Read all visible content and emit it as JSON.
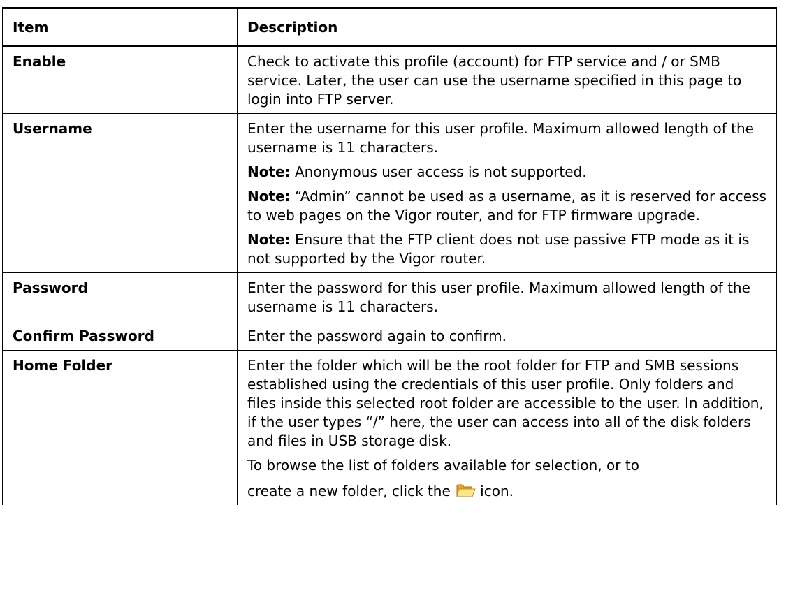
{
  "table": {
    "headers": [
      "Item",
      "Description"
    ],
    "rows": [
      {
        "item": "Enable",
        "paragraphs": [
          {
            "text": "Check to activate this profile (account) for FTP service and / or SMB service. Later, the user can use the username specified in this page to login into FTP server."
          }
        ]
      },
      {
        "item": "Username",
        "paragraphs": [
          {
            "text": "Enter the username for this user profile. Maximum allowed length of the username is 11 characters."
          },
          {
            "note": "Note:",
            "text": " Anonymous user access is not supported."
          },
          {
            "note": "Note:",
            "text": " “Admin” cannot be used as a username, as it is reserved for access to web pages on the Vigor router, and for FTP firmware upgrade."
          },
          {
            "note": "Note:",
            "text": " Ensure that the FTP client does not use passive FTP mode as it is not supported by the Vigor router."
          }
        ]
      },
      {
        "item": "Password",
        "paragraphs": [
          {
            "text": "Enter the password for this user profile. Maximum allowed length of the username is 11 characters."
          }
        ]
      },
      {
        "item": "Confirm Password",
        "paragraphs": [
          {
            "text": "Enter the password again to confirm."
          }
        ]
      },
      {
        "item": "Home Folder",
        "paragraphs": [
          {
            "text": "Enter the folder which will be the root folder for FTP and SMB sessions established using the credentials of this user profile. Only folders and files inside this selected root folder are accessible to the user. In addition, if the user types “/” here, the user can access into all of the disk folders and files in USB storage disk."
          },
          {
            "text": "To browse the list of folders available for selection, or to"
          }
        ],
        "icon_line": {
          "before": "create a new folder, click the",
          "icon": "folder-open-icon",
          "after": "icon."
        }
      }
    ]
  },
  "colors": {
    "border": "#000000",
    "folder_light": "#fde58a",
    "folder_dark": "#e0a526"
  }
}
